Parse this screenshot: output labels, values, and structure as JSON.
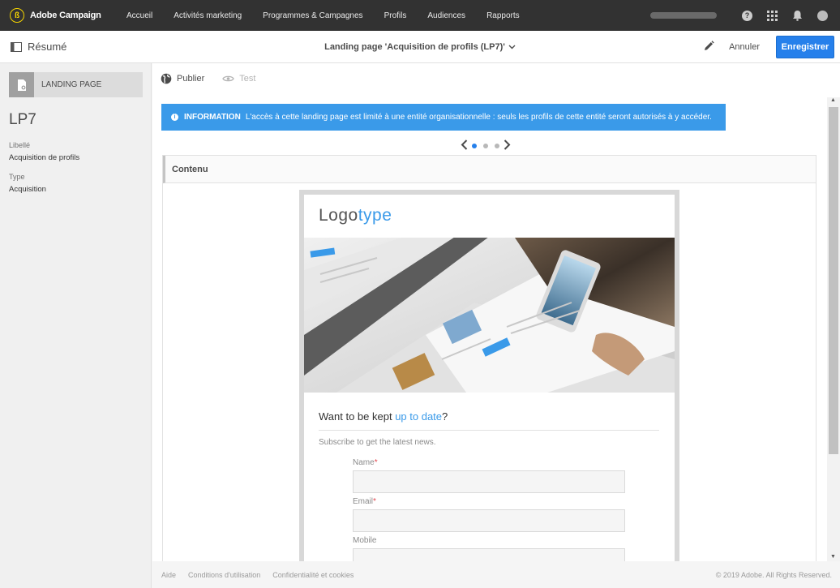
{
  "topbar": {
    "brand_name": "Adobe Campaign",
    "nav": [
      "Accueil",
      "Activités marketing",
      "Programmes & Campagnes",
      "Profils",
      "Audiences",
      "Rapports"
    ]
  },
  "actionbar": {
    "summary_label": "Résumé",
    "title": "Landing page 'Acquisition de profils (LP7)'",
    "cancel_label": "Annuler",
    "save_label": "Enregistrer"
  },
  "sidebar": {
    "badge_label": "LANDING PAGE",
    "name": "LP7",
    "fields": [
      {
        "label": "Libellé",
        "value": "Acquisition de profils"
      },
      {
        "label": "Type",
        "value": "Acquisition"
      }
    ]
  },
  "main": {
    "toolbar": {
      "publish_label": "Publier",
      "test_label": "Test"
    },
    "info": {
      "title": "INFORMATION",
      "text": "L'accès à cette landing page est limité à une entité organisationnelle : seuls les profils de cette entité seront autorisés à y accéder."
    },
    "pager": {
      "pages": 3,
      "current": 1
    },
    "content_label": "Contenu"
  },
  "preview": {
    "logo_part1": "Logo",
    "logo_part2": "type",
    "headline_prefix": "Want to be kept ",
    "headline_highlight": "up to date",
    "headline_suffix": "?",
    "subtitle": "Subscribe to get the latest news.",
    "fields": [
      {
        "label": "Name",
        "required": "*"
      },
      {
        "label": "Email",
        "required": "*"
      },
      {
        "label": "Mobile",
        "required": ""
      }
    ]
  },
  "footer": {
    "links": [
      "Aide",
      "Conditions d'utilisation",
      "Confidentialité et cookies"
    ],
    "copyright": "© 2019 Adobe. All Rights Reserved."
  },
  "colors": {
    "topbar": "#323232",
    "accent": "#2680eb",
    "info": "#3a9ae9",
    "brand_yellow": "#f5d400"
  },
  "icons": [
    "adobe-campaign-logo-icon",
    "help-icon",
    "apps-grid-icon",
    "bell-icon",
    "user-avatar-icon",
    "sidebar-panel-icon",
    "chevron-down-icon",
    "pencil-icon",
    "landing-page-icon",
    "globe-icon",
    "eye-icon",
    "info-icon",
    "chevron-left-icon",
    "chevron-right-icon"
  ]
}
